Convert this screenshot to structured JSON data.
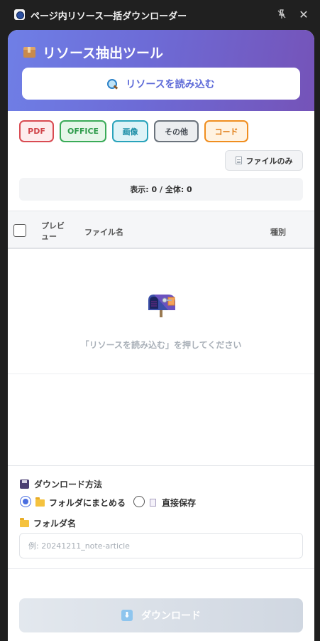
{
  "window": {
    "title": "ページ内リソース一括ダウンローダー",
    "pin_icon": "pin-off-icon",
    "close_glyph": "✕"
  },
  "header": {
    "title": "リソース抽出ツール",
    "title_icon": "package-icon",
    "load_button_label": "リソースを読み込む",
    "load_button_icon": "magnifier-icon",
    "gradient_colors": [
      "#6f7fe6",
      "#7553b8"
    ]
  },
  "filters": [
    {
      "label": "PDF",
      "color": "#d94b52"
    },
    {
      "label": "OFFICE",
      "color": "#3aab58"
    },
    {
      "label": "画像",
      "color": "#29a3bb"
    },
    {
      "label": "その他",
      "color": "#6b737c"
    },
    {
      "label": "コード",
      "color": "#f08e1f"
    }
  ],
  "file_only_button": {
    "label": "ファイルのみ",
    "icon": "document-icon"
  },
  "count_text": "表示: 0 / 全体: 0",
  "table": {
    "columns": [
      "プレビュー",
      "ファイル名",
      "種別"
    ],
    "select_all_checked": false,
    "rows": [],
    "empty_icon": "mailbox-icon",
    "empty_message": "「リソースを読み込む」を押してください"
  },
  "download_options": {
    "method_label": "ダウンロード方法",
    "method_icon": "floppy-disk-icon",
    "methods": [
      {
        "label": "フォルダにまとめる",
        "icon": "folder-icon",
        "selected": true
      },
      {
        "label": "直接保存",
        "icon": "document-icon",
        "selected": false
      }
    ],
    "folder_name_label": "フォルダ名",
    "folder_name_value": "",
    "folder_name_placeholder": "例: 20241211_note-article"
  },
  "download_button": {
    "label": "ダウンロード",
    "icon": "down-arrow-icon",
    "enabled": false
  }
}
